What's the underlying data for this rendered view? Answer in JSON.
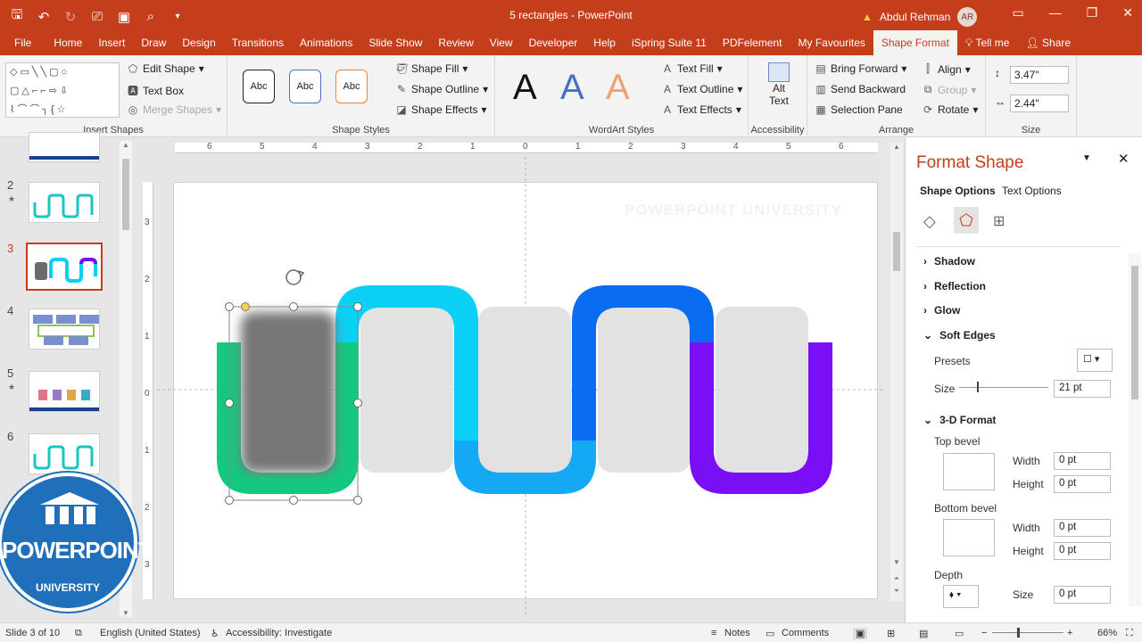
{
  "titlebar": {
    "doc_title": "5 rectangles  -  PowerPoint",
    "user_name": "Abdul Rehman",
    "user_initials": "AR"
  },
  "tabs": [
    "File",
    "Home",
    "Insert",
    "Draw",
    "Design",
    "Transitions",
    "Animations",
    "Slide Show",
    "Review",
    "View",
    "Developer",
    "Help",
    "iSpring Suite 11",
    "PDFelement",
    "My Favourites",
    "Shape Format",
    "Tell me",
    "Share"
  ],
  "ribbon": {
    "insert_shapes": {
      "label": "Insert Shapes",
      "edit_shape": "Edit Shape",
      "text_box": "Text Box",
      "merge_shapes": "Merge Shapes"
    },
    "shape_styles": {
      "label": "Shape Styles",
      "sample": "Abc",
      "shape_fill": "Shape Fill",
      "shape_outline": "Shape Outline",
      "shape_effects": "Shape Effects"
    },
    "wordart": {
      "label": "WordArt Styles",
      "sample": "A",
      "text_fill": "Text Fill",
      "text_outline": "Text Outline",
      "text_effects": "Text Effects"
    },
    "accessibility": {
      "label": "Accessibility",
      "alt_text_1": "Alt",
      "alt_text_2": "Text"
    },
    "arrange": {
      "label": "Arrange",
      "bring_forward": "Bring Forward",
      "send_backward": "Send Backward",
      "selection_pane": "Selection Pane",
      "align": "Align",
      "group": "Group",
      "rotate": "Rotate"
    },
    "size": {
      "label": "Size",
      "height": "3.47\"",
      "width": "2.44\""
    }
  },
  "slides": [
    {
      "num": "2",
      "star": "★"
    },
    {
      "num": "3",
      "star": ""
    },
    {
      "num": "4",
      "star": ""
    },
    {
      "num": "5",
      "star": "★"
    },
    {
      "num": "6",
      "star": ""
    }
  ],
  "ruler": {
    "h": [
      "6",
      "5",
      "4",
      "3",
      "2",
      "1",
      "0",
      "1",
      "2",
      "3",
      "4",
      "5",
      "6"
    ],
    "v": [
      "3",
      "2",
      "1",
      "0",
      "1",
      "2",
      "3"
    ]
  },
  "slide": {
    "watermark": "POWERPOINT UNIVERSITY"
  },
  "pane": {
    "title": "Format Shape",
    "tab_shape": "Shape Options",
    "tab_text": "Text Options",
    "shadow": "Shadow",
    "reflection": "Reflection",
    "glow": "Glow",
    "soft_edges": "Soft Edges",
    "presets": "Presets",
    "size_label": "Size",
    "size_value": "21 pt",
    "format3d": "3-D Format",
    "top_bevel": "Top bevel",
    "bottom_bevel": "Bottom bevel",
    "width": "Width",
    "height": "Height",
    "zero": "0 pt",
    "depth": "Depth",
    "depth_size": "Size"
  },
  "status": {
    "slide_of": "Slide 3 of 10",
    "language": "English (United States)",
    "accessibility": "Accessibility: Investigate",
    "notes": "Notes",
    "comments": "Comments",
    "zoom": "66%"
  },
  "logo": {
    "title": "POWERPOINT",
    "subtitle": "UNIVERSITY"
  },
  "colors": {
    "accent": "#c43e1c",
    "green": "#14c880",
    "cyan": "#0bd0f5",
    "blue": "#0a6cf0",
    "purple": "#7a0ef5",
    "grey": "#e2e2e2"
  }
}
